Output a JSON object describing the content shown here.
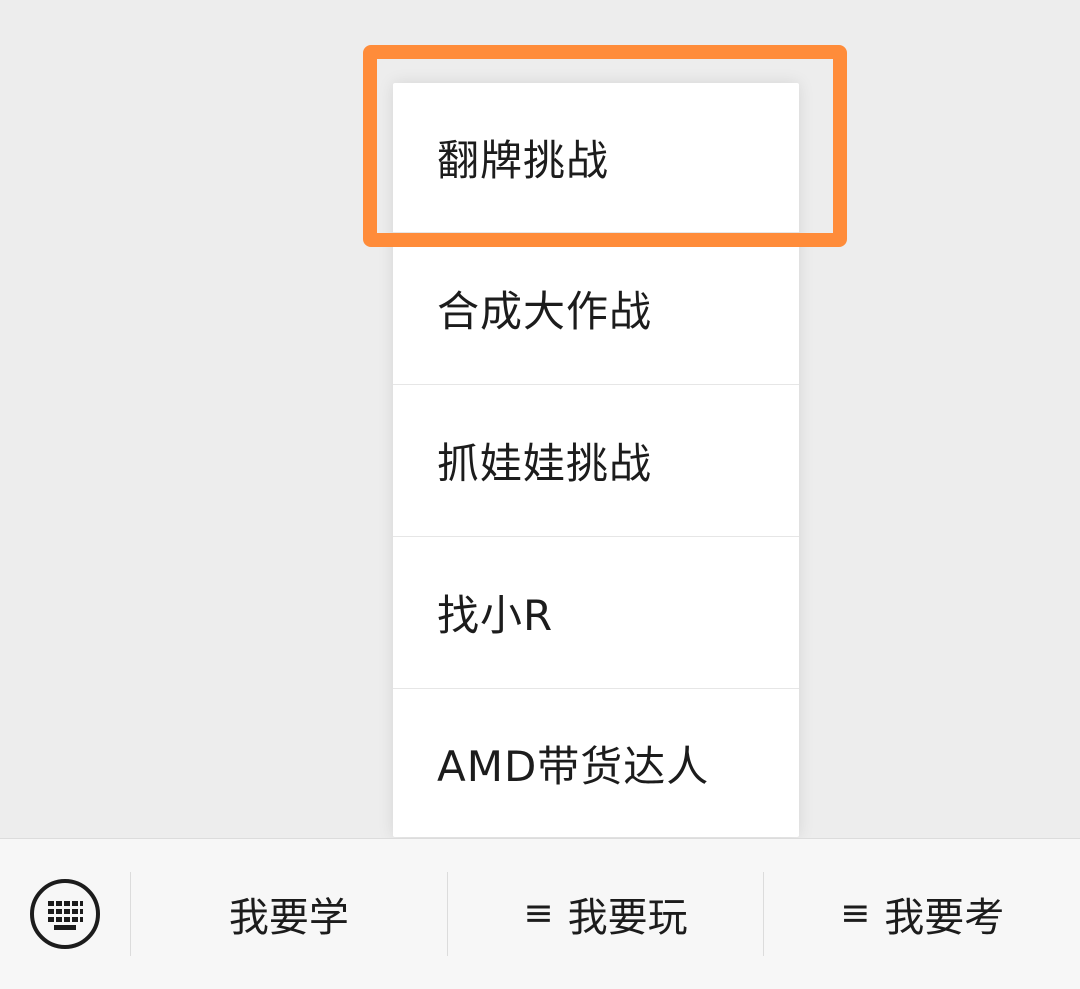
{
  "popup_menu": {
    "items": [
      {
        "label": "翻牌挑战",
        "highlighted": true
      },
      {
        "label": "合成大作战"
      },
      {
        "label": "抓娃娃挑战"
      },
      {
        "label": "找小R"
      },
      {
        "label": "AMD带货达人"
      }
    ],
    "highlight_color": "#ff8c3a"
  },
  "bottom_bar": {
    "keyboard_icon": "keyboard-icon",
    "buttons": [
      {
        "label": "我要学",
        "has_menu_icon": false
      },
      {
        "label": "我要玩",
        "has_menu_icon": true,
        "menu_icon": "≡"
      },
      {
        "label": "我要考",
        "has_menu_icon": true,
        "menu_icon": "≡"
      }
    ]
  }
}
